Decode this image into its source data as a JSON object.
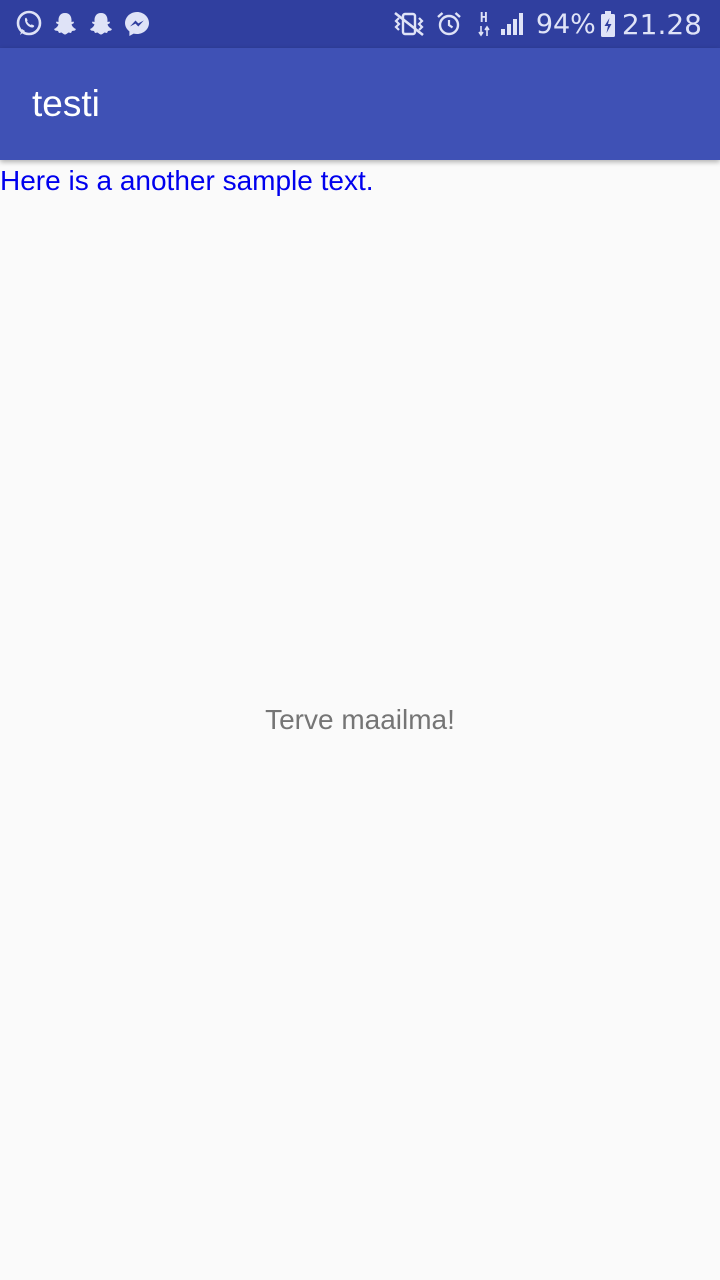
{
  "status_bar": {
    "color": "#303f9f",
    "left_icons": [
      "whatsapp-icon",
      "snapchat-icon",
      "snapchat-icon",
      "messenger-icon"
    ],
    "right_icons": [
      "vibrate-mute-icon",
      "alarm-icon",
      "hspa-data-icon",
      "signal-icon",
      "battery-charging-icon"
    ],
    "network_type": "H",
    "battery_percent": "94%",
    "time": "21.28"
  },
  "app_bar": {
    "color": "#3f51b5",
    "title": "testi"
  },
  "content": {
    "sample_text": "Here is a another sample text.",
    "sample_text_color": "#0000ee",
    "center_text": "Terve maailma!",
    "center_text_color": "#757575"
  }
}
